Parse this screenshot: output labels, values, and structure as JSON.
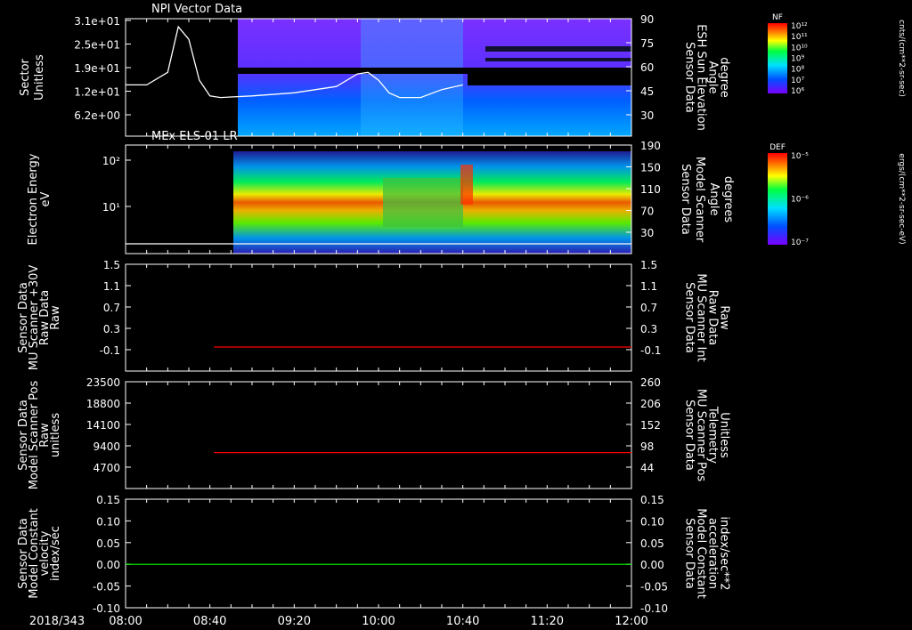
{
  "colors": {
    "background": "#000000",
    "axes": "#ffffff",
    "red_trace": "#ff0000",
    "green_trace": "#00ff00"
  },
  "time_axis": {
    "date_label": "2018/343",
    "ticks": [
      "08:00",
      "08:40",
      "09:20",
      "10:00",
      "10:40",
      "11:20",
      "12:00"
    ]
  },
  "chart_data": [
    {
      "type": "heatmap",
      "title": "NPI Vector Data",
      "ylabel": [
        "Sector",
        "Unitless"
      ],
      "yticks": [
        "3.1e+01",
        "2.5e+01",
        "1.9e+01",
        "1.2e+01",
        "6.2e+00"
      ],
      "y2label": [
        "Sensor Data",
        "ESH Sun Elevation",
        "Angle",
        "degree"
      ],
      "y2ticks": [
        "90",
        "75",
        "60",
        "45",
        "30"
      ],
      "colorbar": {
        "label": "NF",
        "units": "cnts/(cm**2-sr-sec)",
        "ticks": [
          "10¹²",
          "10¹¹",
          "10¹⁰",
          "10⁹",
          "10⁸",
          "10⁷",
          "10⁶"
        ]
      },
      "line_series": {
        "name": "ESH Sun Elevation Angle",
        "x": [
          "08:00",
          "08:10",
          "08:20",
          "08:25",
          "08:30",
          "08:35",
          "08:40",
          "08:45",
          "09:00",
          "09:20",
          "09:40",
          "09:50",
          "09:55",
          "10:00",
          "10:05",
          "10:10",
          "10:20",
          "10:30",
          "10:40"
        ],
        "values": [
          49,
          49,
          57,
          86,
          78,
          52,
          42,
          41,
          42,
          44,
          48,
          56,
          57,
          52,
          44,
          41,
          41,
          46,
          49
        ]
      }
    },
    {
      "type": "heatmap",
      "title": "MEx ELS-01 LR",
      "ylabel": [
        "Electron Energy",
        "eV"
      ],
      "yticks": [
        "10²",
        "10¹"
      ],
      "y2label": [
        "Sensor Data",
        "Model Scanner",
        "Angle",
        "degrees"
      ],
      "y2ticks": [
        "190",
        "150",
        "110",
        "70",
        "30"
      ],
      "colorbar": {
        "label": "DEF",
        "units": "ergs/(cm**2-sr-sec-eV)",
        "ticks": [
          "10⁻⁵",
          "10⁻⁶",
          "10⁻⁷"
        ]
      },
      "line_series": {
        "name": "Model Scanner Angle",
        "x": [
          "08:00",
          "12:00"
        ],
        "values": [
          13,
          13
        ]
      }
    },
    {
      "type": "line",
      "ylabel": [
        "Sensor Data",
        "MU Scanner +30V",
        "Raw Data",
        "Raw"
      ],
      "yticks": [
        "1.5",
        "1.1",
        "0.7",
        "0.3",
        "-0.1"
      ],
      "ylim": [
        -0.5,
        1.5
      ],
      "y2label": [
        "Sensor Data",
        "MU Scanner Int",
        "Raw Data",
        "Raw"
      ],
      "y2ticks": [
        "1.5",
        "1.1",
        "0.7",
        "0.3",
        "-0.1"
      ],
      "series": [
        {
          "x": [
            "08:42",
            "12:00"
          ],
          "values": [
            -0.05,
            -0.05
          ],
          "color": "#ff0000"
        }
      ]
    },
    {
      "type": "line",
      "ylabel": [
        "Sensor Data",
        "Model Scanner Pos",
        "Raw",
        "unitless"
      ],
      "yticks": [
        "23500",
        "18800",
        "14100",
        "9400",
        "4700"
      ],
      "ylim": [
        0,
        23500
      ],
      "y2label": [
        "Sensor Data",
        "MU Scanner Pos",
        "Telemetry",
        "Unitless"
      ],
      "y2ticks": [
        "260",
        "206",
        "152",
        "98",
        "44"
      ],
      "series": [
        {
          "x": [
            "08:42",
            "12:00"
          ],
          "values": [
            7900,
            7900
          ],
          "color": "#ff0000"
        }
      ]
    },
    {
      "type": "line",
      "ylabel": [
        "Sensor Data",
        "Model Constant",
        "velocity",
        "index/sec"
      ],
      "yticks": [
        "0.15",
        "0.10",
        "0.05",
        "0.00",
        "-0.05",
        "-0.10"
      ],
      "ylim": [
        -0.1,
        0.15
      ],
      "y2label": [
        "Sensor Data",
        "Model Constant",
        "acceleration",
        "index/sec**2"
      ],
      "y2ticks": [
        "0.15",
        "0.10",
        "0.05",
        "0.00",
        "-0.05",
        "-0.10"
      ],
      "series": [
        {
          "x": [
            "08:00",
            "12:00"
          ],
          "values": [
            0,
            0
          ],
          "color": "#00ff00"
        }
      ]
    }
  ]
}
